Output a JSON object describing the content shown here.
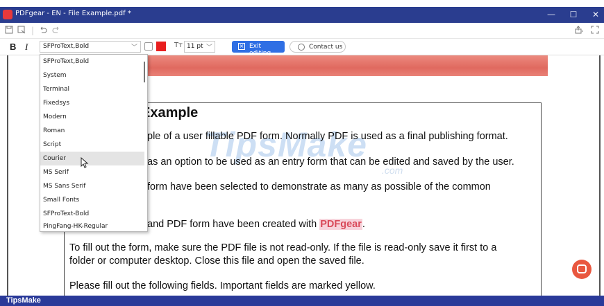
{
  "window": {
    "title": "PDFgear - EN - File Example.pdf *",
    "controls": {
      "minimize": "—",
      "maximize": "☐",
      "close": "✕"
    }
  },
  "toolbar_top": {
    "icons": [
      "save-icon",
      "save-as-icon",
      "undo-icon",
      "redo-icon",
      "share-icon",
      "fullscreen-icon"
    ]
  },
  "format_toolbar": {
    "bold": "B",
    "italic": "I",
    "font_value": "SFProText,Bold",
    "font_color": "#e81e1e",
    "size_icon": "Tт",
    "size_value": "11 pt",
    "exit_label": "Exit editing",
    "contact_label": "Contact us"
  },
  "font_dropdown": {
    "items": [
      "SFProText,Bold",
      "System",
      "Terminal",
      "Fixedsys",
      "Modern",
      "Roman",
      "Script",
      "Courier",
      "MS Serif",
      "MS Sans Serif",
      "Small Fonts",
      "SFProText-Bold",
      "PingFang-HK-Regular"
    ],
    "hovered": "Courier"
  },
  "document": {
    "heading": "Example",
    "line1": "ple of a user fillable PDF form. Normally PDF is used as a final publishing format.",
    "line2": "as an option to be used as an entry form that can be edited and saved by the user.",
    "line3": "form have been selected to demonstrate as many as possible of the common",
    "line4_prefix": "and PDF form have been created with ",
    "line4_brand": "PDFgear",
    "line4_suffix": ".",
    "line5": "To fill out the form, make sure the PDF file is not read-only. If the file is read-only save it first to a",
    "line6": "folder or computer desktop. Close this file and open the saved file.",
    "line7": "Please fill out the following fields. Important fields are marked yellow."
  },
  "watermark": {
    "main": "TipsMake",
    "sub": ".com"
  },
  "footer": {
    "label": "TipsMake"
  },
  "colors": {
    "titlebar": "#2a3d8f",
    "accent": "#2f6fe4",
    "banner": "#e0695f",
    "brand": "#d94a5a",
    "assistant": "#e9573f"
  }
}
